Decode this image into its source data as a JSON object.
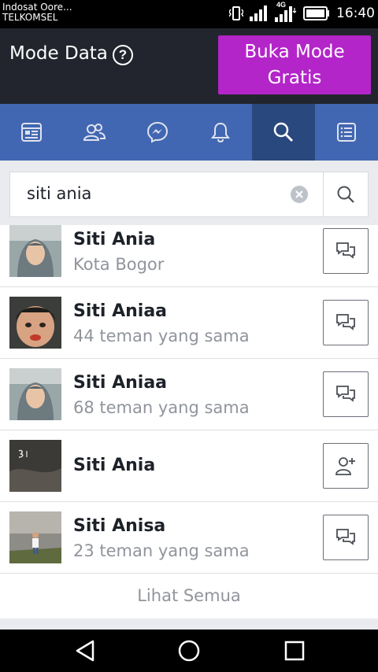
{
  "status_bar": {
    "carrier_line_1": "Indosat Oore...",
    "carrier_line_2": "TELKOMSEL",
    "network_type": "4G",
    "time": "16:40"
  },
  "mode_bar": {
    "label": "Mode Data",
    "help_glyph": "?",
    "free_mode_button": "Buka Mode Gratis",
    "button_color": "#b325c9"
  },
  "nav_tabs": [
    {
      "icon": "news-feed-icon"
    },
    {
      "icon": "friends-icon"
    },
    {
      "icon": "messenger-icon"
    },
    {
      "icon": "notifications-icon"
    },
    {
      "icon": "search-icon",
      "active": true
    },
    {
      "icon": "menu-icon"
    }
  ],
  "search": {
    "query": "siti ania"
  },
  "results": [
    {
      "name": "Siti Ania",
      "subtitle": "Kota Bogor",
      "action": "message-icon"
    },
    {
      "name": "Siti Aniaa",
      "subtitle": "44 teman yang sama",
      "action": "message-icon"
    },
    {
      "name": "Siti Aniaa",
      "subtitle": "68 teman yang sama",
      "action": "message-icon"
    },
    {
      "name": "Siti Ania",
      "subtitle": "",
      "action": "add-friend-icon"
    },
    {
      "name": "Siti Anisa",
      "subtitle": "23 teman yang sama",
      "action": "message-icon"
    }
  ],
  "see_all": "Lihat Semua",
  "colors": {
    "facebook_blue": "#4267b2",
    "active_tab": "#29487d",
    "secondary_text": "#90949c"
  }
}
